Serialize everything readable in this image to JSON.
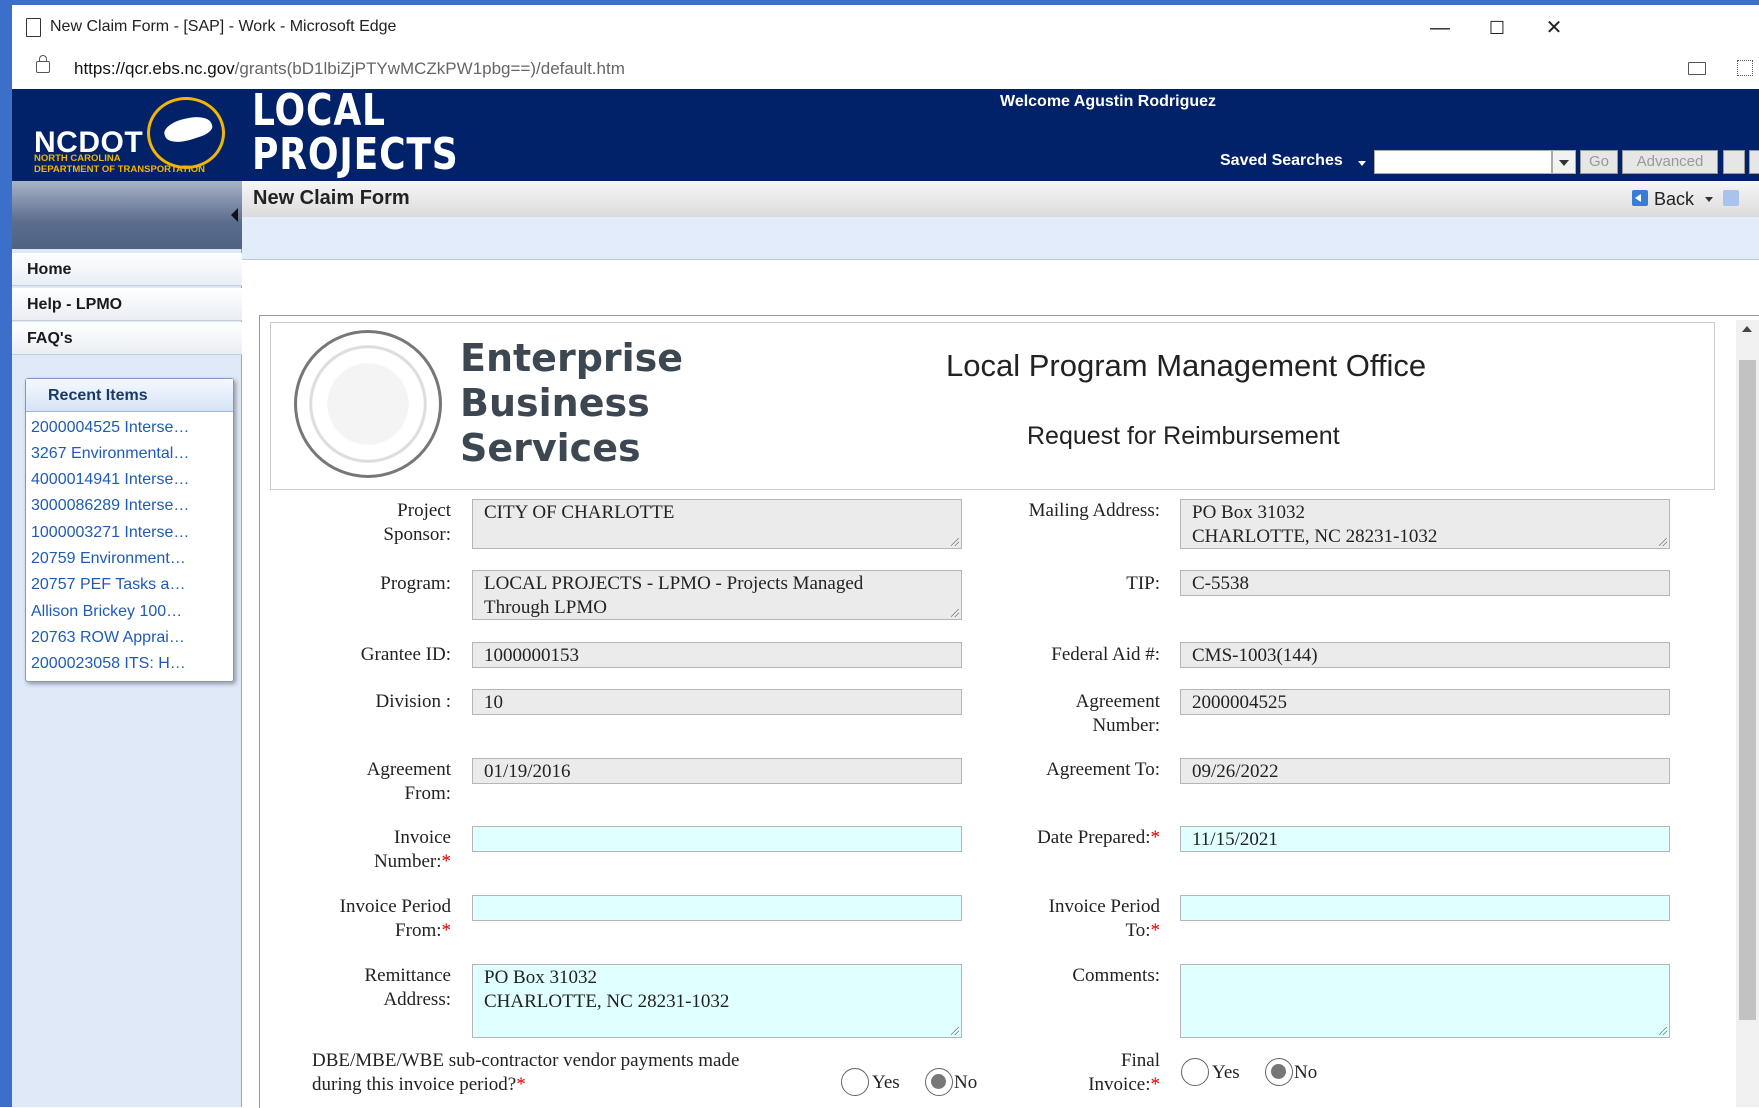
{
  "browser": {
    "window_title": "New Claim Form - [SAP] - Work - Microsoft Edge",
    "url_domain": "https://qcr.ebs.nc.gov",
    "url_path": "/grants(bD1lbiZjPTYwMCZkPW1pbg==)/default.htm",
    "minimize": "—",
    "maximize": "☐",
    "close": "✕"
  },
  "header": {
    "logo_text": "NCDOT",
    "logo_sub_1": "NORTH CAROLINA",
    "logo_sub_2": "DEPARTMENT OF TRANSPORTATION",
    "app_name_1": "LOCAL",
    "app_name_2": "PROJECTS",
    "welcome": "Welcome Agustin Rodriguez",
    "saved_searches": "Saved Searches",
    "go": "Go",
    "advanced": "Advanced"
  },
  "sidebar": {
    "items": [
      {
        "label": "Home"
      },
      {
        "label": "Help - LPMO"
      },
      {
        "label": "FAQ's"
      }
    ],
    "recent_title": "Recent Items",
    "recent": [
      "2000004525 Interse…",
      "3267 Environmental…",
      "4000014941 Interse…",
      "3000086289 Interse…",
      "1000003271 Interse…",
      "20759 Environment…",
      "20757 PEF Tasks a…",
      "Allison Brickey 100…",
      "20763 ROW Apprai…",
      "2000023058 ITS: H…"
    ]
  },
  "page": {
    "title": "New Claim Form",
    "back": "Back"
  },
  "form_header": {
    "ebs_1": "Enterprise",
    "ebs_2": "Business",
    "ebs_3": "Services",
    "office": "Local Program Management Office",
    "subtitle": "Request for Reimbursement"
  },
  "form": {
    "project_sponsor": {
      "label_1": "Project",
      "label_2": "Sponsor:",
      "value": "CITY OF CHARLOTTE"
    },
    "mailing_address": {
      "label": "Mailing Address:",
      "value": "PO Box 31032\nCHARLOTTE, NC 28231-1032"
    },
    "program": {
      "label": "Program:",
      "value": "LOCAL PROJECTS - LPMO     - Projects Managed\nThrough LPMO"
    },
    "tip": {
      "label": "TIP:",
      "value": "C-5538"
    },
    "grantee_id": {
      "label": "Grantee ID:",
      "value": "1000000153"
    },
    "federal_aid": {
      "label": "Federal Aid #:",
      "value": "CMS-1003(144)"
    },
    "division": {
      "label": "Division :",
      "value": "10"
    },
    "agreement_number": {
      "label_1": "Agreement",
      "label_2": "Number:",
      "value": "2000004525"
    },
    "agreement_from": {
      "label_1": "Agreement",
      "label_2": "From:",
      "value": "01/19/2016"
    },
    "agreement_to": {
      "label": "Agreement To:",
      "value": "09/26/2022"
    },
    "invoice_number": {
      "label_1": "Invoice",
      "label_2": "Number:",
      "value": ""
    },
    "date_prepared": {
      "label": "Date Prepared:",
      "value": "11/15/2021"
    },
    "invoice_period_from": {
      "label_1": "Invoice Period",
      "label_2": "From:",
      "value": ""
    },
    "invoice_period_to": {
      "label_1": "Invoice Period",
      "label_2": "To:",
      "value": ""
    },
    "remittance_address": {
      "label_1": "Remittance",
      "label_2": "Address:",
      "value": "PO Box 31032\nCHARLOTTE, NC 28231-1032"
    },
    "comments": {
      "label": "Comments:",
      "value": ""
    },
    "dbe": {
      "label_1": "DBE/MBE/WBE sub-contractor vendor payments made",
      "label_2": "during this invoice period?",
      "yes": "Yes",
      "no": "No",
      "selected": "No"
    },
    "final_invoice": {
      "label_1": "Final",
      "label_2": "Invoice:",
      "yes": "Yes",
      "no": "No",
      "selected": "No"
    },
    "required_mark": "*"
  },
  "colors": {
    "header_bg": "#012169",
    "accent_gold": "#f2b600",
    "editable_field": "#e0ffff",
    "readonly_field": "#ebebeb",
    "link": "#1f5bb5"
  }
}
